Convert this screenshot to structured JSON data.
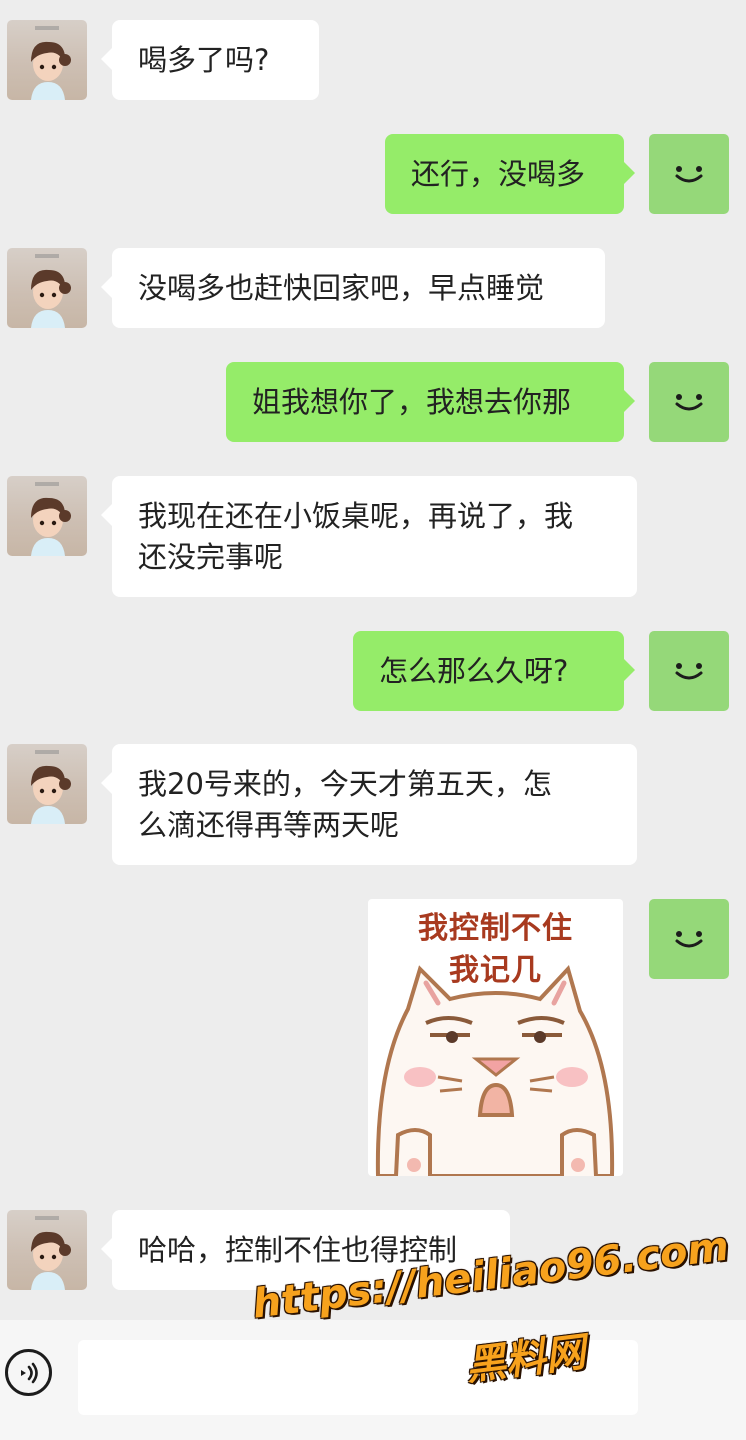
{
  "messages": [
    {
      "from": "her",
      "text": "喝多了吗?"
    },
    {
      "from": "me",
      "text": "还行，没喝多"
    },
    {
      "from": "her",
      "text": "没喝多也赶快回家吧，早点睡觉"
    },
    {
      "from": "me",
      "text": "姐我想你了，我想去你那"
    },
    {
      "from": "her",
      "text": "我现在还在小饭桌呢，再说了，我\n还没完事呢"
    },
    {
      "from": "me",
      "text": "怎么那么久呀?"
    },
    {
      "from": "her",
      "text": "我20号来的，今天才第五天，怎\n么滴还得再等两天呢"
    },
    {
      "from": "me",
      "type": "sticker",
      "sticker": {
        "line1": "我控制不住",
        "line2": "我记几",
        "icon": "grumpy-cat-sticker"
      }
    },
    {
      "from": "her",
      "text": "哈哈，控制不住也得控制"
    }
  ],
  "input_bar": {
    "voice_icon": "voice-icon",
    "field_value": ""
  },
  "watermark": {
    "url": "https://heiliao96.com",
    "cn": "黑料网"
  },
  "colors": {
    "background": "#ededed",
    "outgoing_bubble": "#95ec69",
    "incoming_bubble": "#ffffff",
    "my_avatar": "#95d879",
    "watermark": "#f7a21d"
  }
}
